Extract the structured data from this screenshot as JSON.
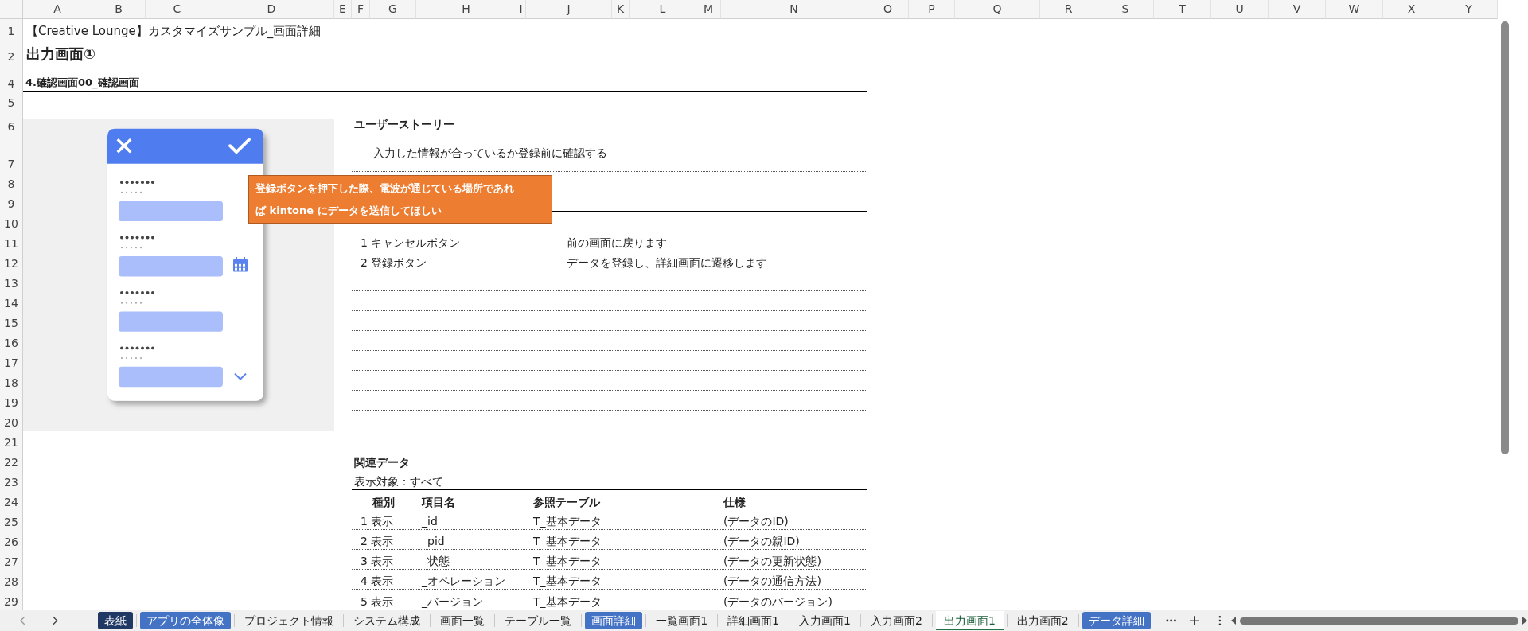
{
  "columns": [
    "A",
    "B",
    "C",
    "D",
    "E",
    "F",
    "G",
    "H",
    "I",
    "J",
    "K",
    "L",
    "M",
    "N",
    "O",
    "P",
    "Q",
    "R",
    "S",
    "T",
    "U",
    "V",
    "W",
    "X",
    "Y"
  ],
  "row_headers": [
    "1",
    "2",
    "4",
    "5",
    "6",
    "7",
    "8",
    "9",
    "10",
    "11",
    "12",
    "13",
    "14",
    "15",
    "16",
    "17",
    "18",
    "19",
    "20",
    "21",
    "22",
    "23",
    "24",
    "25",
    "26",
    "27",
    "28",
    "29"
  ],
  "doc_title": "【Creative Lounge】カスタマイズサンプル_画面詳細",
  "screen_title": "出力画面①",
  "section_heading": "4.確認画面00_確認画面",
  "callout": {
    "text": "登録ボタンを押下した際、電波が通じている場所であれば kintone にデータを送信してほしい"
  },
  "user_story": {
    "heading": "ユーザーストーリー",
    "text": "入力した情報が合っているか登録前に確認する"
  },
  "components_table": {
    "rows": [
      {
        "no": "1",
        "name": "キャンセルボタン",
        "spec": "前の画面に戻ります"
      },
      {
        "no": "2",
        "name": "登録ボタン",
        "spec": "データを登録し、詳細画面に遷移します"
      }
    ]
  },
  "related_data": {
    "heading": "関連データ",
    "filter": "表示対象：すべて",
    "columns": [
      "種別",
      "項目名",
      "参照テーブル",
      "仕様"
    ],
    "rows": [
      {
        "no": "1",
        "kind": "表示",
        "name": "_id",
        "table": "T_基本データ",
        "spec": "(データのID)"
      },
      {
        "no": "2",
        "kind": "表示",
        "name": "_pid",
        "table": "T_基本データ",
        "spec": "(データの親ID)"
      },
      {
        "no": "3",
        "kind": "表示",
        "name": "_状態",
        "table": "T_基本データ",
        "spec": "(データの更新状態)"
      },
      {
        "no": "4",
        "kind": "表示",
        "name": "_オペレーション",
        "table": "T_基本データ",
        "spec": "(データの通信方法)"
      },
      {
        "no": "5",
        "kind": "表示",
        "name": "_バージョン",
        "table": "T_基本データ",
        "spec": "(データのバージョン)"
      }
    ]
  },
  "sheet_tabs": [
    {
      "label": "表紙",
      "selected": false,
      "color": "#203864"
    },
    {
      "label": "アプリの全体像",
      "selected": false,
      "color": "#4472c4"
    },
    {
      "label": "プロジェクト情報",
      "selected": false
    },
    {
      "label": "システム構成",
      "selected": false
    },
    {
      "label": "画面一覧",
      "selected": false
    },
    {
      "label": "テーブル一覧",
      "selected": false
    },
    {
      "label": "画面詳細",
      "selected": false,
      "color": "#4472c4"
    },
    {
      "label": "一覧画面1",
      "selected": false
    },
    {
      "label": "詳細画面1",
      "selected": false
    },
    {
      "label": "入力画面1",
      "selected": false
    },
    {
      "label": "入力画面2",
      "selected": false
    },
    {
      "label": "出力画面1",
      "selected": true
    },
    {
      "label": "出力画面2",
      "selected": false
    },
    {
      "label": "データ詳細",
      "selected": false,
      "color": "#4472c4"
    }
  ]
}
